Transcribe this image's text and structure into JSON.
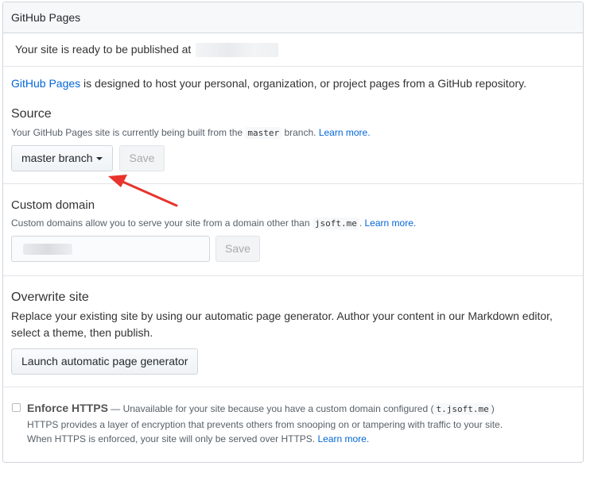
{
  "panel": {
    "title": "GitHub Pages"
  },
  "notice": {
    "text": "Your site is ready to be published at "
  },
  "intro": {
    "link": "GitHub Pages",
    "text": " is designed to host your personal, organization, or project pages from a GitHub repository."
  },
  "source": {
    "title": "Source",
    "desc_before": "Your GitHub Pages site is currently being built from the ",
    "branch_code": "master",
    "desc_after": " branch. ",
    "learn_more": "Learn more.",
    "branch_button": "master branch",
    "save_button": "Save"
  },
  "custom_domain": {
    "title": "Custom domain",
    "desc_before": "Custom domains allow you to serve your site from a domain other than ",
    "domain_code": "jsoft.me",
    "desc_after": ". ",
    "learn_more": "Learn more.",
    "save_button": "Save"
  },
  "overwrite": {
    "title": "Overwrite site",
    "desc": "Replace your existing site by using our automatic page generator. Author your content in our Markdown editor, select a theme, then publish.",
    "button": "Launch automatic page generator"
  },
  "https": {
    "label": "Enforce HTTPS",
    "note_before": " — Unavailable for your site because you have a custom domain configured (",
    "domain_code": "t.jsoft.me",
    "note_after": ")",
    "line2": "HTTPS provides a layer of encryption that prevents others from snooping on or tampering with traffic to your site.",
    "line3": "When HTTPS is enforced, your site will only be served over HTTPS. ",
    "learn_more": "Learn more."
  },
  "colors": {
    "link": "#0366d6",
    "annotation_arrow": "#e8342c"
  }
}
